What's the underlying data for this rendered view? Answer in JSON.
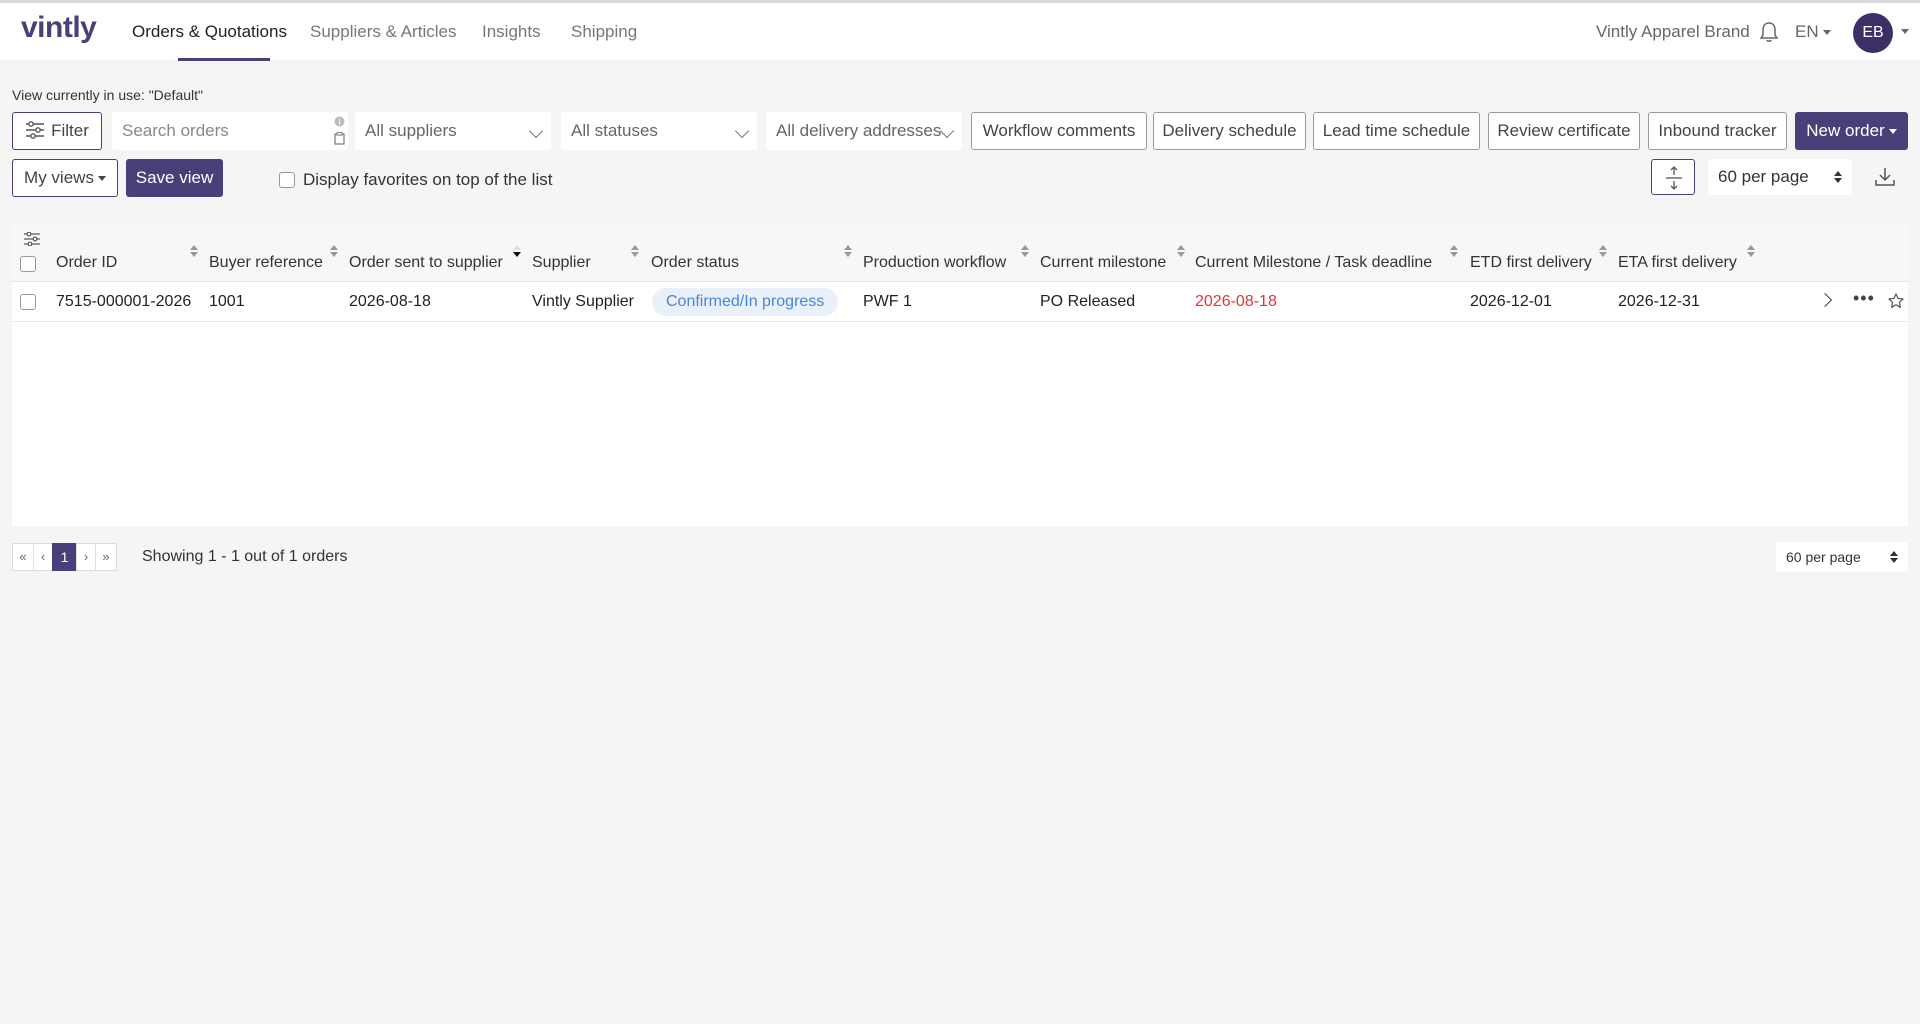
{
  "nav": {
    "logo": "vintly",
    "items": [
      {
        "label": "Orders & Quotations",
        "active": true
      },
      {
        "label": "Suppliers & Articles",
        "active": false
      },
      {
        "label": "Insights",
        "active": false
      },
      {
        "label": "Shipping",
        "active": false
      }
    ],
    "brand": "Vintly Apparel Brand",
    "language": "EN",
    "avatar_initials": "EB",
    "accent_color": "#4a3f78"
  },
  "toolbar": {
    "view_in_use": "View currently in use: \"Default\"",
    "filter_label": "Filter",
    "search_placeholder": "Search orders",
    "suppliers_select": "All suppliers",
    "statuses_select": "All statuses",
    "delivery_select": "All delivery addresses",
    "buttons": [
      "Workflow comments",
      "Delivery schedule",
      "Lead time schedule",
      "Review certificate",
      "Inbound tracker"
    ],
    "new_order_label": "New order",
    "my_views_label": "My views",
    "save_view_label": "Save view",
    "favorites_label": "Display favorites on top of the list",
    "per_page": "60 per page"
  },
  "table": {
    "columns": [
      "Order ID",
      "Buyer reference",
      "Order sent to supplier",
      "Supplier",
      "Order status",
      "Production workflow",
      "Current milestone",
      "Current Milestone / Task deadline",
      "ETD first delivery",
      "ETA first delivery"
    ],
    "rows": [
      {
        "order_id": "7515-000001-2026",
        "buyer_reference": "1001",
        "order_sent": "2026-08-18",
        "supplier": "Vintly Supplier",
        "order_status": "Confirmed/In progress",
        "production_workflow": "PWF 1",
        "current_milestone": "PO Released",
        "milestone_deadline": "2026-08-18",
        "etd_first_delivery": "2026-12-01",
        "eta_first_delivery": "2026-12-31"
      }
    ]
  },
  "pagination": {
    "first": "«",
    "prev": "‹",
    "current_page": "1",
    "next": "›",
    "last": "»",
    "showing": "Showing 1 - 1 out of 1 orders",
    "per_page": "60 per page"
  }
}
